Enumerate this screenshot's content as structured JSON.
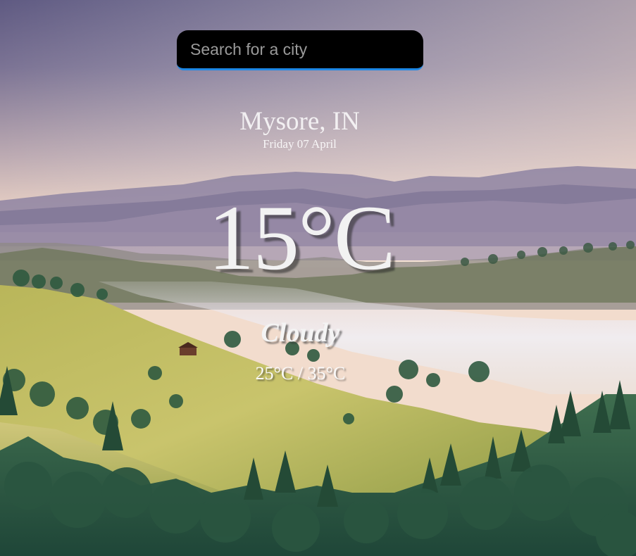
{
  "search": {
    "placeholder": "Search for a city",
    "value": ""
  },
  "location": {
    "city": "Mysore, IN",
    "date": "Friday 07 April"
  },
  "current": {
    "temperature": "15°C",
    "condition": "Cloudy",
    "range": "25°C / 35°C"
  },
  "theme": {
    "accent": "#1e88e5",
    "search_bg": "#000000",
    "text": "#ffffff"
  },
  "background": {
    "scene": "misty mountain valley landscape"
  }
}
